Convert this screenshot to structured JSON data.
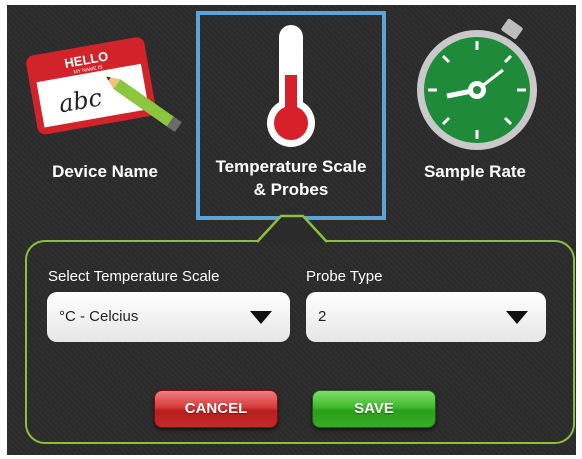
{
  "tabs": {
    "device_name": {
      "label": "Device Name",
      "sticker_header": "HELLO",
      "sticker_sub": "MY NAME IS",
      "sticker_text": "abc",
      "icon": "name-tag-icon"
    },
    "temperature": {
      "label_line1": "Temperature Scale",
      "label_line2": "& Probes",
      "icon": "thermometer-icon",
      "selected": true
    },
    "sample_rate": {
      "label": "Sample Rate",
      "icon": "stopwatch-icon"
    }
  },
  "form": {
    "scale_label": "Select Temperature Scale",
    "scale_value": "°C - Celcius",
    "probe_label": "Probe Type",
    "probe_value": "2"
  },
  "buttons": {
    "cancel": "CANCEL",
    "save": "SAVE"
  },
  "colors": {
    "selected_border": "#5ea2d6",
    "panel_border": "#8cbf3f",
    "cancel": "#d73a3a",
    "save": "#3fbb2c",
    "thermometer": "#d8202a",
    "stopwatch_face": "#1f8a3a"
  }
}
